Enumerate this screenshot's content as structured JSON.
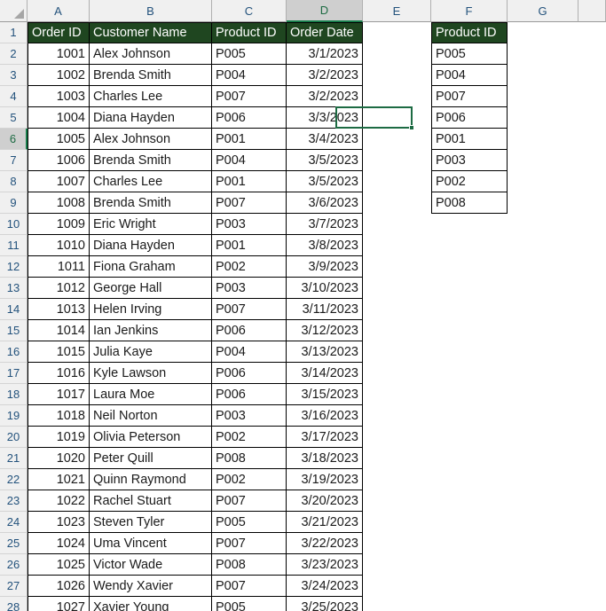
{
  "app": {
    "type": "spreadsheet",
    "select_all_icon": "select-all-triangle"
  },
  "columns": {
    "letters": [
      "A",
      "B",
      "C",
      "D",
      "E",
      "F",
      "G"
    ],
    "active": "D"
  },
  "rows": {
    "numbers": [
      "1",
      "2",
      "3",
      "4",
      "5",
      "6",
      "7",
      "8",
      "9",
      "10",
      "11",
      "12",
      "13",
      "14",
      "15",
      "16",
      "17",
      "18",
      "19",
      "20",
      "21",
      "22",
      "23",
      "24",
      "25",
      "26",
      "27",
      "28"
    ],
    "active": "6"
  },
  "selection": {
    "active_cell": "D6",
    "active_cell_value": "3/4/2023",
    "border_color": "#1d6b43",
    "has_fill_handle": true
  },
  "theme": {
    "header_fill": "#1f4620",
    "header_text": "#ffffff",
    "grid_border": "#000000",
    "rowcol_header_bg": "#f0f0f0",
    "rowcol_header_text": "#23527c",
    "active_header_bg": "#cfcfcf",
    "active_header_text": "#1d6b43"
  },
  "orders_table": {
    "range": "A1:D28",
    "headers": [
      "Order ID",
      "Customer Name",
      "Product ID",
      "Order Date"
    ],
    "rows": [
      [
        "1001",
        "Alex Johnson",
        "P005",
        "3/1/2023"
      ],
      [
        "1002",
        "Brenda Smith",
        "P004",
        "3/2/2023"
      ],
      [
        "1003",
        "Charles Lee",
        "P007",
        "3/2/2023"
      ],
      [
        "1004",
        "Diana Hayden",
        "P006",
        "3/3/2023"
      ],
      [
        "1005",
        "Alex Johnson",
        "P001",
        "3/4/2023"
      ],
      [
        "1006",
        "Brenda Smith",
        "P004",
        "3/5/2023"
      ],
      [
        "1007",
        "Charles Lee",
        "P001",
        "3/5/2023"
      ],
      [
        "1008",
        "Brenda Smith",
        "P007",
        "3/6/2023"
      ],
      [
        "1009",
        "Eric Wright",
        "P003",
        "3/7/2023"
      ],
      [
        "1010",
        "Diana Hayden",
        "P001",
        "3/8/2023"
      ],
      [
        "1011",
        "Fiona Graham",
        "P002",
        "3/9/2023"
      ],
      [
        "1012",
        "George Hall",
        "P003",
        "3/10/2023"
      ],
      [
        "1013",
        "Helen Irving",
        "P007",
        "3/11/2023"
      ],
      [
        "1014",
        "Ian Jenkins",
        "P006",
        "3/12/2023"
      ],
      [
        "1015",
        "Julia Kaye",
        "P004",
        "3/13/2023"
      ],
      [
        "1016",
        "Kyle Lawson",
        "P006",
        "3/14/2023"
      ],
      [
        "1017",
        "Laura Moe",
        "P006",
        "3/15/2023"
      ],
      [
        "1018",
        "Neil Norton",
        "P003",
        "3/16/2023"
      ],
      [
        "1019",
        "Olivia Peterson",
        "P002",
        "3/17/2023"
      ],
      [
        "1020",
        "Peter Quill",
        "P008",
        "3/18/2023"
      ],
      [
        "1021",
        "Quinn Raymond",
        "P002",
        "3/19/2023"
      ],
      [
        "1022",
        "Rachel Stuart",
        "P007",
        "3/20/2023"
      ],
      [
        "1023",
        "Steven Tyler",
        "P005",
        "3/21/2023"
      ],
      [
        "1024",
        "Uma Vincent",
        "P007",
        "3/22/2023"
      ],
      [
        "1025",
        "Victor Wade",
        "P008",
        "3/23/2023"
      ],
      [
        "1026",
        "Wendy Xavier",
        "P007",
        "3/24/2023"
      ],
      [
        "1027",
        "Xavier Young",
        "P005",
        "3/25/2023"
      ]
    ]
  },
  "unique_products_table": {
    "range": "F1:F9",
    "header": "Product ID",
    "values": [
      "P005",
      "P004",
      "P007",
      "P006",
      "P001",
      "P003",
      "P002",
      "P008"
    ]
  }
}
